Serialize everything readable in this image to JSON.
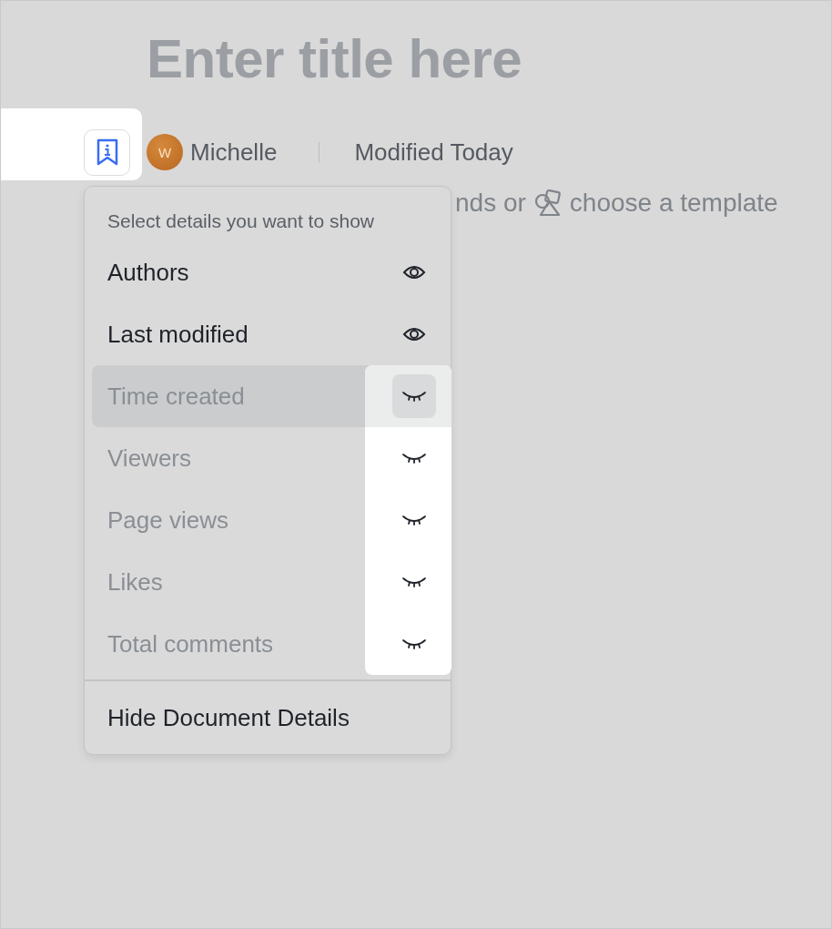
{
  "title_placeholder": "Enter title here",
  "meta": {
    "author_initial": "W",
    "author": "Michelle",
    "modified": "Modified Today"
  },
  "hint": {
    "before": "nds or",
    "after": "choose a template"
  },
  "details_menu": {
    "header": "Select details you want to show",
    "items": [
      {
        "label": "Authors",
        "visible": true,
        "highlighted": false
      },
      {
        "label": "Last modified",
        "visible": true,
        "highlighted": false
      },
      {
        "label": "Time created",
        "visible": false,
        "highlighted": true
      },
      {
        "label": "Viewers",
        "visible": false,
        "highlighted": false
      },
      {
        "label": "Page views",
        "visible": false,
        "highlighted": false
      },
      {
        "label": "Likes",
        "visible": false,
        "highlighted": false
      },
      {
        "label": "Total comments",
        "visible": false,
        "highlighted": false
      }
    ],
    "footer": "Hide Document Details"
  }
}
